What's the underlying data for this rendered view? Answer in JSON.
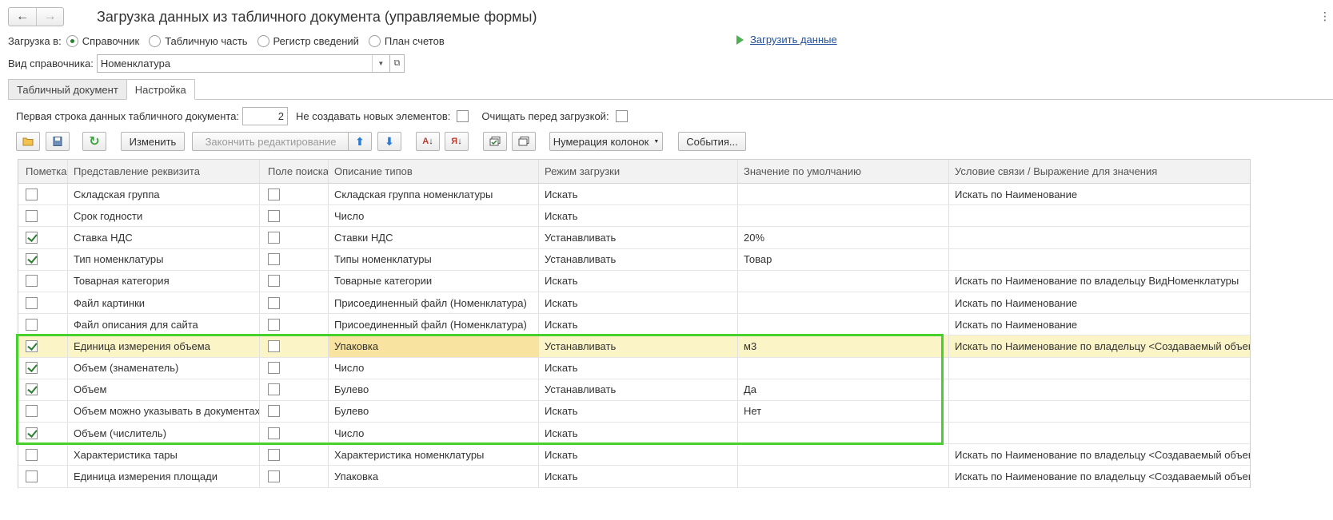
{
  "header": {
    "title": "Загрузка данных из табличного документа (управляемые формы)",
    "back_icon": "←",
    "forward_icon": "→",
    "more_icon": "⋮"
  },
  "load_to": {
    "label": "Загрузка в:",
    "options": [
      "Справочник",
      "Табличную часть",
      "Регистр сведений",
      "План счетов"
    ],
    "selected": "Справочник"
  },
  "load_link": "Загрузить данные",
  "catalog_kind": {
    "label": "Вид справочника:",
    "value": "Номенклатура"
  },
  "tabs": [
    "Табличный документ",
    "Настройка"
  ],
  "active_tab": "Настройка",
  "settings": {
    "first_row_label": "Первая строка данных табличного документа:",
    "first_row_value": "2",
    "no_new_label": "Не создавать новых элементов:",
    "clear_label": "Очищать перед загрузкой:"
  },
  "toolbar": {
    "edit": "Изменить",
    "finish_edit": "Закончить редактирование",
    "numbering": "Нумерация колонок",
    "events": "События..."
  },
  "table": {
    "columns": [
      "Пометка",
      "Представление реквизита",
      "Поле поиска",
      "Описание типов",
      "Режим загрузки",
      "Значение по умолчанию",
      "Условие связи / Выражение для значения"
    ],
    "rows": [
      {
        "mark": false,
        "name": "Складская группа",
        "search": false,
        "type": "Складская группа номенклатуры",
        "mode": "Искать",
        "default": "",
        "cond": "Искать по Наименование"
      },
      {
        "mark": false,
        "name": "Срок годности",
        "search": false,
        "type": "Число",
        "mode": "Искать",
        "default": "",
        "cond": ""
      },
      {
        "mark": true,
        "name": "Ставка НДС",
        "search": false,
        "type": "Ставки НДС",
        "mode": "Устанавливать",
        "default": "20%",
        "cond": ""
      },
      {
        "mark": true,
        "name": "Тип номенклатуры",
        "search": false,
        "type": "Типы номенклатуры",
        "mode": "Устанавливать",
        "default": "Товар",
        "cond": ""
      },
      {
        "mark": false,
        "name": "Товарная категория",
        "search": false,
        "type": "Товарные категории",
        "mode": "Искать",
        "default": "",
        "cond": "Искать по Наименование по владельцу ВидНоменклатуры"
      },
      {
        "mark": false,
        "name": "Файл картинки",
        "search": false,
        "type": "Присоединенный файл (Номенклатура)",
        "mode": "Искать",
        "default": "",
        "cond": "Искать по Наименование"
      },
      {
        "mark": false,
        "name": "Файл описания для сайта",
        "search": false,
        "type": "Присоединенный файл (Номенклатура)",
        "mode": "Искать",
        "default": "",
        "cond": "Искать по Наименование"
      },
      {
        "mark": true,
        "name": "Единица измерения объема",
        "search": false,
        "type": "Упаковка",
        "mode": "Устанавливать",
        "default": "м3",
        "cond": "Искать по Наименование по владельцу <Создаваемый объект>",
        "selected": true
      },
      {
        "mark": true,
        "name": "Объем (знаменатель)",
        "search": false,
        "type": "Число",
        "mode": "Искать",
        "default": "",
        "cond": ""
      },
      {
        "mark": true,
        "name": "Объем",
        "search": false,
        "type": "Булево",
        "mode": "Устанавливать",
        "default": "Да",
        "cond": ""
      },
      {
        "mark": false,
        "name": "Объем можно указывать в документах",
        "search": false,
        "type": "Булево",
        "mode": "Искать",
        "default": "Нет",
        "cond": ""
      },
      {
        "mark": true,
        "name": "Объем (числитель)",
        "search": false,
        "type": "Число",
        "mode": "Искать",
        "default": "",
        "cond": ""
      },
      {
        "mark": false,
        "name": "Характеристика тары",
        "search": false,
        "type": "Характеристика номенклатуры",
        "mode": "Искать",
        "default": "",
        "cond": "Искать по Наименование по владельцу <Создаваемый объект>"
      },
      {
        "mark": false,
        "name": "Единица измерения площади",
        "search": false,
        "type": "Упаковка",
        "mode": "Искать",
        "default": "",
        "cond": "Искать по Наименование по владельцу <Создаваемый объект>"
      }
    ]
  },
  "colors": {
    "accent_green": "#47d12c",
    "selected_row": "#fbf4c6",
    "link": "#1f4f9b"
  }
}
